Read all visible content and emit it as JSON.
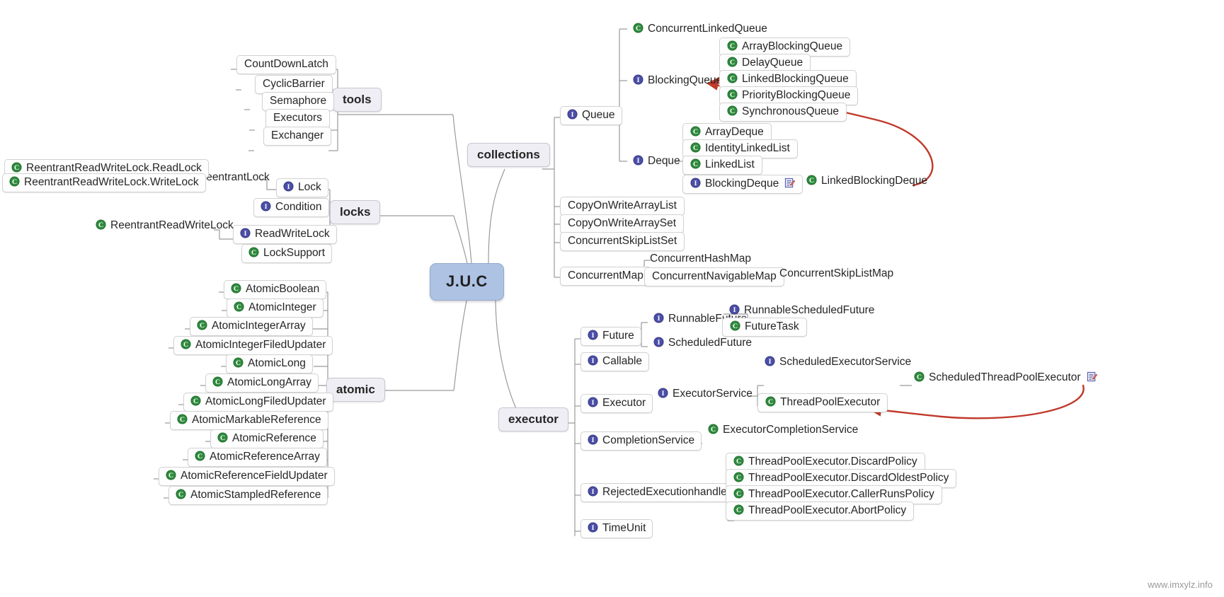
{
  "watermark": "www.imxylz.info",
  "root": {
    "label": "J.U.C"
  },
  "icons": {
    "class": "class-icon",
    "interface": "interface-icon",
    "note": "note-icon"
  },
  "colors": {
    "root_fill": "#aec2e3",
    "branch_fill": "#eeeef4",
    "class_icon": "#2e8b3d",
    "interface_icon": "#4b4fa8",
    "arrow": "#c0392b",
    "line": "#9a9a9a"
  },
  "branches": {
    "tools": {
      "label": "tools"
    },
    "locks": {
      "label": "locks"
    },
    "atomic": {
      "label": "atomic"
    },
    "collections": {
      "label": "collections"
    },
    "executor": {
      "label": "executor"
    }
  },
  "nodes": {
    "tools_children": [
      {
        "label": "CountDownLatch",
        "icon": "none"
      },
      {
        "label": "CyclicBarrier",
        "icon": "none"
      },
      {
        "label": "Semaphore",
        "icon": "none"
      },
      {
        "label": "Executors",
        "icon": "none"
      },
      {
        "label": "Exchanger",
        "icon": "none"
      }
    ],
    "locks_children": [
      {
        "label": "Lock",
        "icon": "interface"
      },
      {
        "label": "Condition",
        "icon": "interface"
      },
      {
        "label": "ReadWriteLock",
        "icon": "interface"
      },
      {
        "label": "LockSupport",
        "icon": "class"
      }
    ],
    "lock_children": [
      {
        "label": "ReentrantLock",
        "icon": "none"
      }
    ],
    "reentrantlock_children": [
      {
        "label": "ReentrantReadWriteLock.ReadLock",
        "icon": "class"
      },
      {
        "label": "ReentrantReadWriteLock.WriteLock",
        "icon": "class"
      }
    ],
    "readwritelock_children": [
      {
        "label": "ReentrantReadWriteLock",
        "icon": "class"
      }
    ],
    "atomic_children": [
      {
        "label": "AtomicBoolean",
        "icon": "class"
      },
      {
        "label": "AtomicInteger",
        "icon": "class"
      },
      {
        "label": "AtomicIntegerArray",
        "icon": "class"
      },
      {
        "label": "AtomicIntegerFiledUpdater",
        "icon": "class"
      },
      {
        "label": "AtomicLong",
        "icon": "class"
      },
      {
        "label": "AtomicLongArray",
        "icon": "class"
      },
      {
        "label": "AtomicLongFiledUpdater",
        "icon": "class"
      },
      {
        "label": "AtomicMarkableReference",
        "icon": "class"
      },
      {
        "label": "AtomicReference",
        "icon": "class"
      },
      {
        "label": "AtomicReferenceArray",
        "icon": "class"
      },
      {
        "label": "AtomicReferenceFieldUpdater",
        "icon": "class"
      },
      {
        "label": "AtomicStampledReference",
        "icon": "class"
      }
    ],
    "collections_children": [
      {
        "label": "Queue",
        "icon": "interface"
      },
      {
        "label": "CopyOnWriteArrayList",
        "icon": "none"
      },
      {
        "label": "CopyOnWriteArraySet",
        "icon": "none"
      },
      {
        "label": "ConcurrentSkipListSet",
        "icon": "none"
      },
      {
        "label": "ConcurrentMap",
        "icon": "none"
      }
    ],
    "queue_children": [
      {
        "label": "ConcurrentLinkedQueue",
        "icon": "class"
      },
      {
        "label": "BlockingQueue",
        "icon": "interface"
      },
      {
        "label": "Deque",
        "icon": "interface"
      }
    ],
    "blockingqueue_children": [
      {
        "label": "ArrayBlockingQueue",
        "icon": "class"
      },
      {
        "label": "DelayQueue",
        "icon": "class"
      },
      {
        "label": "LinkedBlockingQueue",
        "icon": "class"
      },
      {
        "label": "PriorityBlockingQueue",
        "icon": "class"
      },
      {
        "label": "SynchronousQueue",
        "icon": "class"
      }
    ],
    "deque_children": [
      {
        "label": "ArrayDeque",
        "icon": "class"
      },
      {
        "label": "IdentityLinkedList",
        "icon": "class"
      },
      {
        "label": "LinkedList",
        "icon": "class"
      },
      {
        "label": "BlockingDeque",
        "icon": "interface",
        "note": true
      }
    ],
    "blockingdeque_children": [
      {
        "label": "LinkedBlockingDeque",
        "icon": "class"
      }
    ],
    "concurrentmap_children": [
      {
        "label": "ConcurrentHashMap",
        "icon": "none"
      },
      {
        "label": "ConcurrentNavigableMap",
        "icon": "none"
      }
    ],
    "concurrentnavigablemap_children": [
      {
        "label": "ConcurrentSkipListMap",
        "icon": "none"
      }
    ],
    "executor_children": [
      {
        "label": "Future",
        "icon": "interface"
      },
      {
        "label": "Callable",
        "icon": "interface"
      },
      {
        "label": "Executor",
        "icon": "interface"
      },
      {
        "label": "CompletionService",
        "icon": "interface"
      },
      {
        "label": "RejectedExecutionhandler",
        "icon": "interface"
      },
      {
        "label": "TimeUnit",
        "icon": "interface"
      }
    ],
    "future_children": [
      {
        "label": "RunnableFuture",
        "icon": "interface"
      },
      {
        "label": "ScheduledFuture",
        "icon": "interface"
      }
    ],
    "runnablefuture_children": [
      {
        "label": "RunnableScheduledFuture",
        "icon": "interface"
      },
      {
        "label": "FutureTask",
        "icon": "class"
      }
    ],
    "executor_iface_children": [
      {
        "label": "ExecutorService",
        "icon": "interface"
      }
    ],
    "executorservice_children": [
      {
        "label": "ScheduledExecutorService",
        "icon": "interface"
      },
      {
        "label": "ThreadPoolExecutor",
        "icon": "class"
      }
    ],
    "scheduledexecutorservice_children": [
      {
        "label": "ScheduledThreadPoolExecutor",
        "icon": "class",
        "note": true
      }
    ],
    "completionservice_children": [
      {
        "label": "ExecutorCompletionService",
        "icon": "class"
      }
    ],
    "rejectedhandler_children": [
      {
        "label": "ThreadPoolExecutor.DiscardPolicy",
        "icon": "class"
      },
      {
        "label": "ThreadPoolExecutor.DiscardOldestPolicy",
        "icon": "class"
      },
      {
        "label": "ThreadPoolExecutor.CallerRunsPolicy",
        "icon": "class"
      },
      {
        "label": "ThreadPoolExecutor.AbortPolicy",
        "icon": "class"
      }
    ]
  }
}
